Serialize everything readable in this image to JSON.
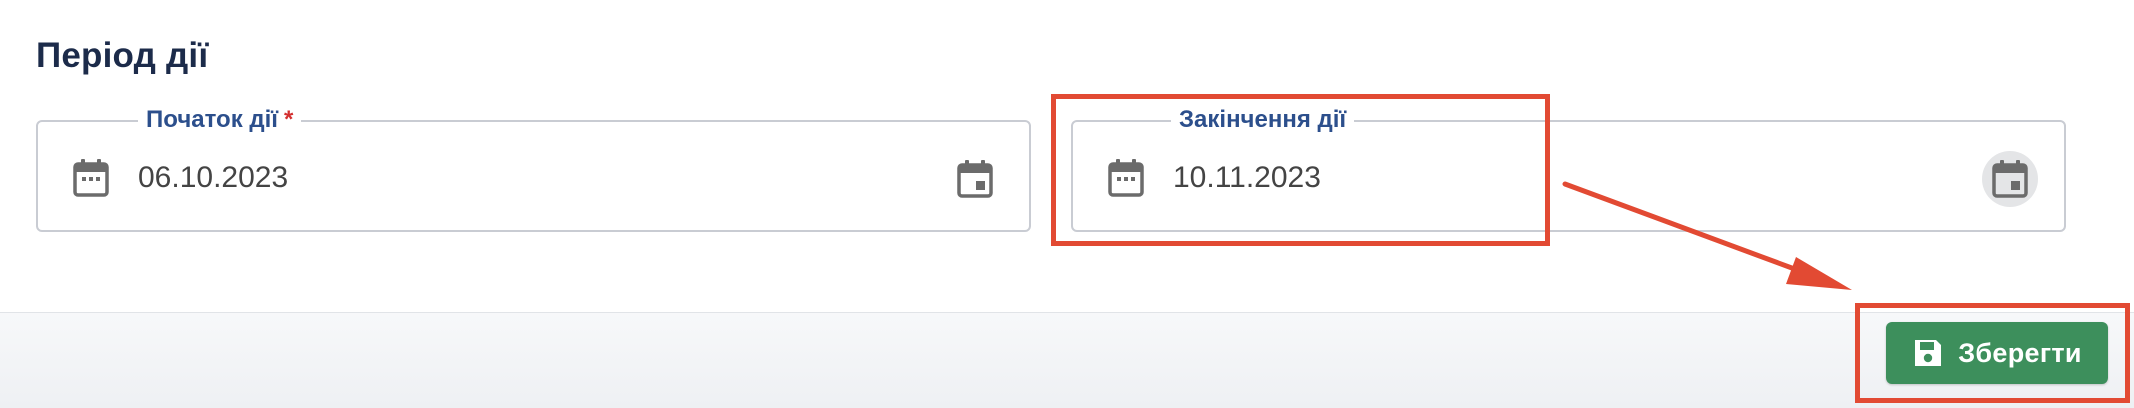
{
  "section": {
    "title": "Період дії"
  },
  "start_field": {
    "label": "Початок дії",
    "required_mark": "*",
    "value": "06.10.2023",
    "left_icon": "calendar-outline-icon",
    "right_icon": "calendar-today-icon"
  },
  "end_field": {
    "label": "Закінчення дії",
    "value": "10.11.2023",
    "left_icon": "calendar-outline-icon",
    "right_icon": "calendar-today-icon"
  },
  "footer": {
    "save_label": "Зберегти",
    "save_icon": "floppy-disk-icon"
  },
  "colors": {
    "title": "#1c2b4a",
    "label": "#2c4f8c",
    "required": "#d32f2f",
    "save_button": "#3d8f5c",
    "annotation": "#e24a33",
    "icon_gray": "#6b6b6b"
  }
}
